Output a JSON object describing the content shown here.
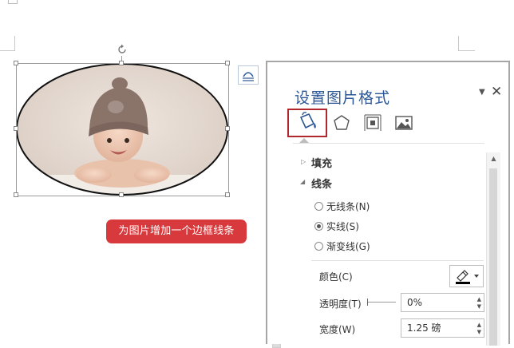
{
  "callout": {
    "text": "为图片增加一个边框线条"
  },
  "pane": {
    "title": "设置图片格式",
    "tabs": [
      {
        "name": "fill-line",
        "icon": "paint-bucket-icon",
        "active": true
      },
      {
        "name": "effects",
        "icon": "pentagon-icon",
        "active": false
      },
      {
        "name": "size-properties",
        "icon": "size-layout-icon",
        "active": false
      },
      {
        "name": "picture",
        "icon": "picture-icon",
        "active": false
      }
    ],
    "sections": {
      "fill": {
        "label": "填充",
        "expanded": false
      },
      "line": {
        "label": "线条",
        "expanded": true
      }
    },
    "line_options": [
      {
        "label": "无线条(N)",
        "selected": false
      },
      {
        "label": "实线(S)",
        "selected": true
      },
      {
        "label": "渐变线(G)",
        "selected": false
      }
    ],
    "color_label": "颜色(C)",
    "transparency_label": "透明度(T)",
    "transparency_value": "0%",
    "width_label": "宽度(W)",
    "width_value": "1.25 磅"
  },
  "colors": {
    "accent_title": "#2b5797",
    "callout_bg": "#d8393c",
    "active_tab_border": "#b0282c"
  }
}
